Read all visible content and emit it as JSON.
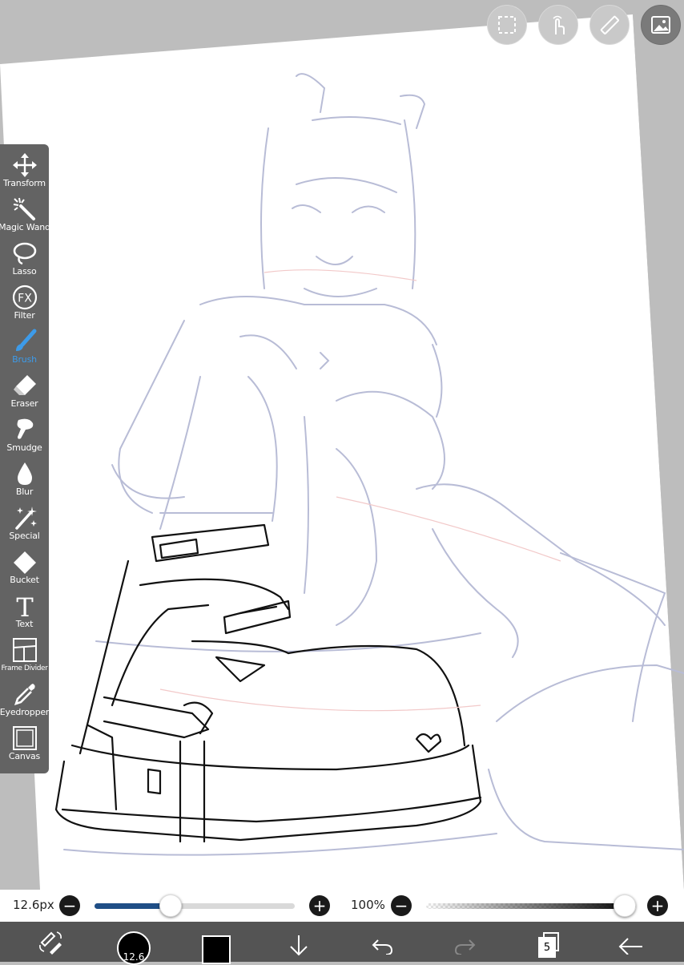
{
  "toolbar": {
    "items": [
      {
        "label": "Transform",
        "icon": "transform-icon"
      },
      {
        "label": "Magic Wand",
        "icon": "magic-wand-icon"
      },
      {
        "label": "Lasso",
        "icon": "lasso-icon"
      },
      {
        "label": "Filter",
        "icon": "fx-icon",
        "icon_text": "FX"
      },
      {
        "label": "Brush",
        "icon": "brush-icon",
        "active": true
      },
      {
        "label": "Eraser",
        "icon": "eraser-icon"
      },
      {
        "label": "Smudge",
        "icon": "smudge-icon"
      },
      {
        "label": "Blur",
        "icon": "blur-icon"
      },
      {
        "label": "Special",
        "icon": "special-icon"
      },
      {
        "label": "Bucket",
        "icon": "bucket-icon"
      },
      {
        "label": "Text",
        "icon": "text-icon",
        "icon_text": "T"
      },
      {
        "label": "Frame Divider",
        "icon": "frame-divider-icon"
      },
      {
        "label": "Eyedropper",
        "icon": "eyedropper-icon"
      },
      {
        "label": "Canvas",
        "icon": "canvas-icon"
      }
    ]
  },
  "top_buttons": [
    {
      "icon": "selection-icon"
    },
    {
      "icon": "touch-icon"
    },
    {
      "icon": "ruler-icon"
    },
    {
      "icon": "image-icon"
    }
  ],
  "sliders": {
    "brush_size_label": "12.6px",
    "brush_size_fraction": 0.38,
    "opacity_label": "100%",
    "opacity_fraction": 1.0,
    "minus": "−",
    "plus": "+"
  },
  "actions": {
    "brush_size_value": "12.6",
    "layer_count": "5",
    "color": "#000000"
  },
  "colors": {
    "accent": "#3d9be9",
    "toolbar_bg": "#636363",
    "action_bar_bg": "#545454",
    "slider_fill": "#1f4e86"
  }
}
